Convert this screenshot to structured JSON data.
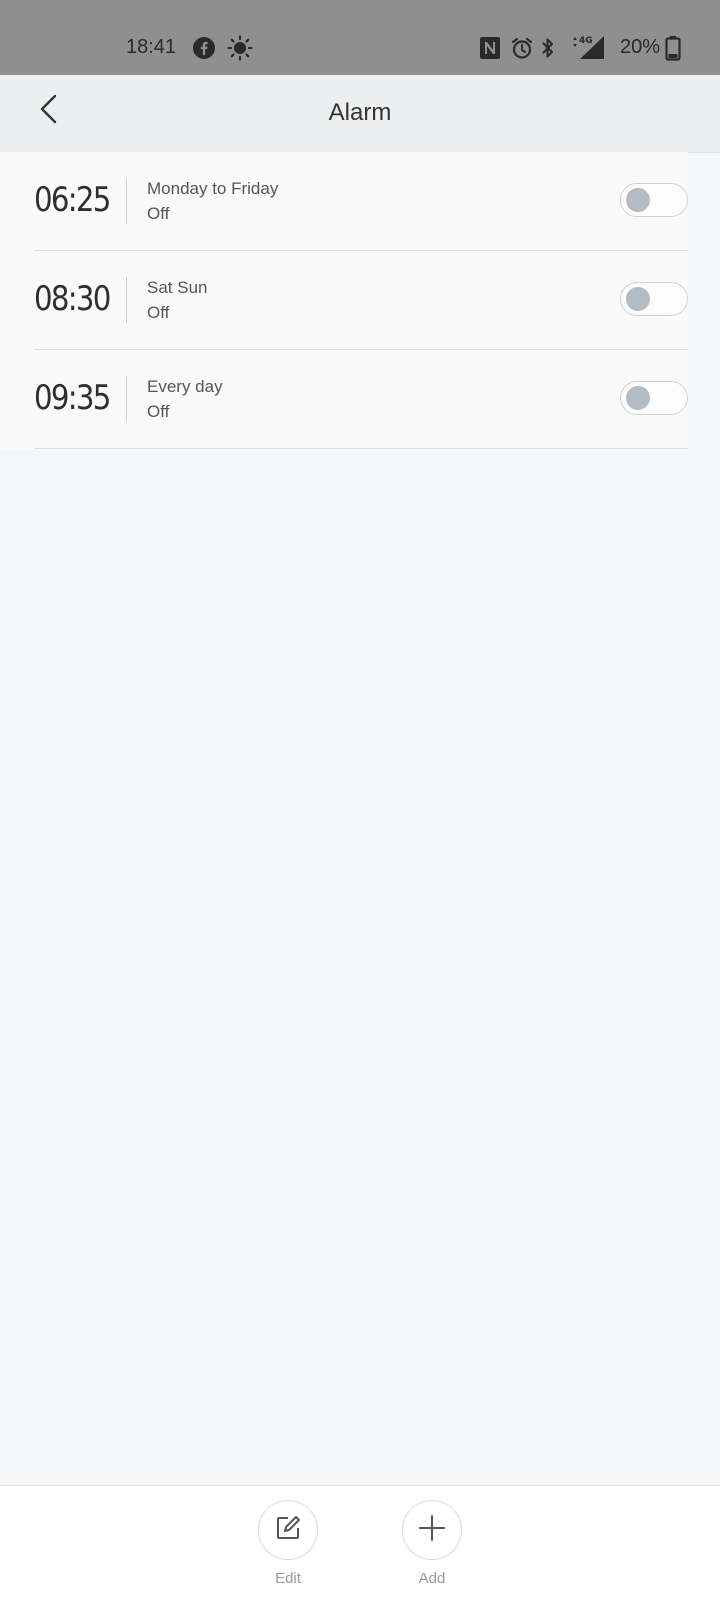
{
  "status_bar": {
    "time": "18:41",
    "battery": "20%",
    "network": "4G",
    "left_icons": [
      "facebook-icon",
      "brightness-icon"
    ],
    "right_icons": [
      "nfc-icon",
      "alarm-clock-icon",
      "bluetooth-icon",
      "signal-icon",
      "battery-icon"
    ]
  },
  "header": {
    "title": "Alarm",
    "back_icon": "chevron-left-icon"
  },
  "alarms": [
    {
      "time": "06:25",
      "days": "Monday to Friday",
      "status": "Off",
      "enabled": false
    },
    {
      "time": "08:30",
      "days": "Sat Sun",
      "status": "Off",
      "enabled": false
    },
    {
      "time": "09:35",
      "days": "Every day",
      "status": "Off",
      "enabled": false
    }
  ],
  "bottom_bar": {
    "edit_label": "Edit",
    "add_label": "Add",
    "edit_icon": "edit-icon",
    "add_icon": "plus-icon"
  },
  "colors": {
    "status_bar_bg": "#8f8f8f",
    "header_bg": "#eceeef",
    "page_bg": "#f4f6f8",
    "toggle_knob": "#b4bcc3"
  }
}
